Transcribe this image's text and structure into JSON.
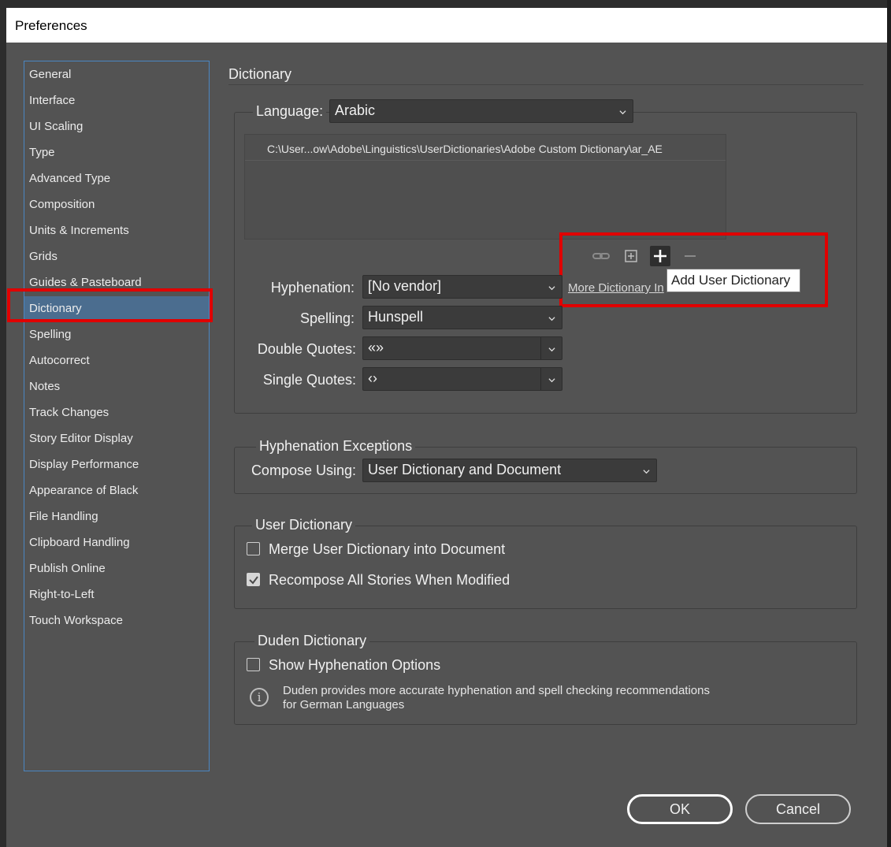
{
  "window": {
    "title": "Preferences"
  },
  "sidebar": {
    "items": [
      {
        "label": "General"
      },
      {
        "label": "Interface"
      },
      {
        "label": "UI Scaling"
      },
      {
        "label": "Type"
      },
      {
        "label": "Advanced Type"
      },
      {
        "label": "Composition"
      },
      {
        "label": "Units & Increments"
      },
      {
        "label": "Grids"
      },
      {
        "label": "Guides & Pasteboard"
      },
      {
        "label": "Dictionary"
      },
      {
        "label": "Spelling"
      },
      {
        "label": "Autocorrect"
      },
      {
        "label": "Notes"
      },
      {
        "label": "Track Changes"
      },
      {
        "label": "Story Editor Display"
      },
      {
        "label": "Display Performance"
      },
      {
        "label": "Appearance of Black"
      },
      {
        "label": "File Handling"
      },
      {
        "label": "Clipboard Handling"
      },
      {
        "label": "Publish Online"
      },
      {
        "label": "Right-to-Left"
      },
      {
        "label": "Touch Workspace"
      }
    ],
    "selected": "Dictionary"
  },
  "panel": {
    "title": "Dictionary",
    "language": {
      "label": "Language:",
      "value": "Arabic"
    },
    "dictionary_path": "C:\\User...ow\\Adobe\\Linguistics\\UserDictionaries\\Adobe Custom Dictionary\\ar_AE",
    "toolbar": {
      "relink_icon": "link-icon",
      "new_icon": "new-dictionary-icon",
      "add_icon": "plus-icon",
      "remove_icon": "minus-icon",
      "tooltip": "Add User Dictionary"
    },
    "more_link": "More Dictionary In",
    "hyphenation": {
      "label": "Hyphenation:",
      "value": "[No vendor]"
    },
    "spelling": {
      "label": "Spelling:",
      "value": "Hunspell"
    },
    "double_quotes": {
      "label": "Double Quotes:",
      "value": "«»"
    },
    "single_quotes": {
      "label": "Single Quotes:",
      "value": "‹›"
    },
    "hyphenation_exceptions": {
      "legend": "Hyphenation Exceptions",
      "compose_label": "Compose Using:",
      "compose_value": "User Dictionary and Document"
    },
    "user_dictionary": {
      "legend": "User Dictionary",
      "merge_label": "Merge User Dictionary into Document",
      "merge_checked": false,
      "recompose_label": "Recompose All Stories When Modified",
      "recompose_checked": true
    },
    "duden": {
      "legend": "Duden Dictionary",
      "show_label": "Show Hyphenation Options",
      "show_checked": false,
      "info_line1": "Duden provides more accurate hyphenation and spell checking recommendations",
      "info_line2": "for German Languages"
    }
  },
  "buttons": {
    "ok": "OK",
    "cancel": "Cancel"
  },
  "colors": {
    "highlight": "#e00000",
    "selection": "#4b6d8f",
    "dialog_bg": "#535353"
  }
}
